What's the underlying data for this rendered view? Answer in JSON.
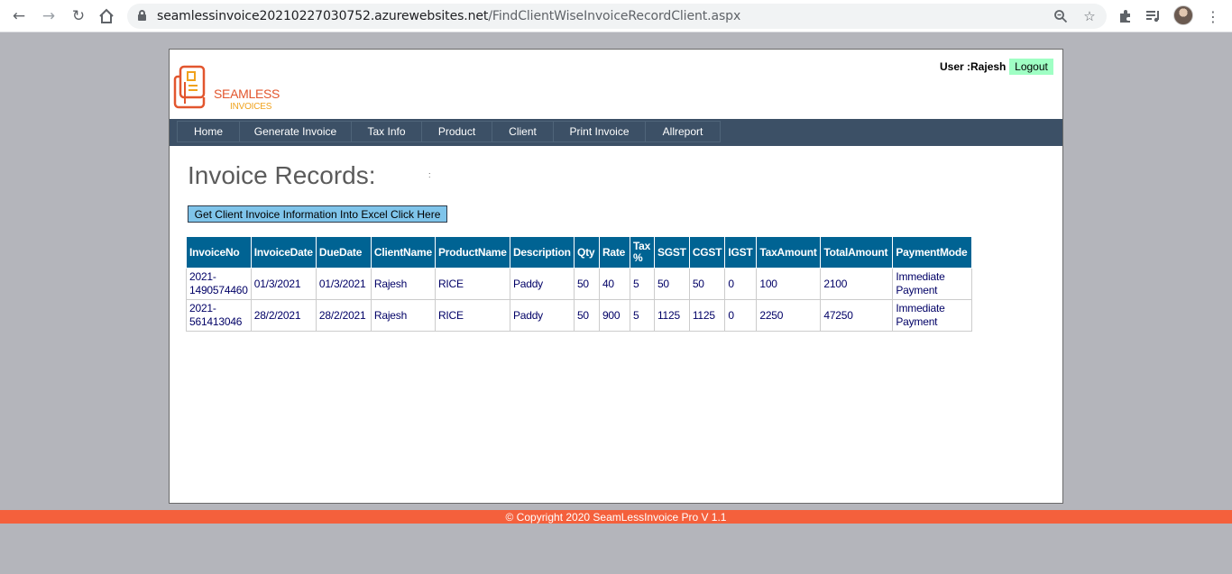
{
  "browser": {
    "url_host": "seamlessinvoice20210227030752.azurewebsites.net",
    "url_path": "/FindClientWiseInvoiceRecordClient.aspx"
  },
  "logo": {
    "line1": "SEAMLESS",
    "line2": "INVOICES",
    "colors": {
      "primary": "#e2562e",
      "secondary": "#f0a21c"
    }
  },
  "header": {
    "user_label": "User :Rajesh",
    "logout_label": "Logout"
  },
  "nav": {
    "items": [
      "Home",
      "Generate Invoice",
      "Tax Info",
      "Product",
      "Client",
      "Print Invoice",
      "Allreport"
    ]
  },
  "main": {
    "title": "Invoice Records:",
    "marker": ":",
    "excel_button": "Get Client Invoice Information Into Excel Click Here"
  },
  "table": {
    "headers": [
      "InvoiceNo",
      "InvoiceDate",
      "DueDate",
      "ClientName",
      "ProductName",
      "Description",
      "Qty",
      "Rate",
      "Tax %",
      "SGST",
      "CGST",
      "IGST",
      "TaxAmount",
      "TotalAmount",
      "PaymentMode"
    ],
    "rows": [
      [
        "2021-1490574460",
        "01/3/2021",
        "01/3/2021",
        "Rajesh",
        "RICE",
        "Paddy",
        "50",
        "40",
        "5",
        "50",
        "50",
        "0",
        "100",
        "2100",
        "Immediate Payment"
      ],
      [
        "2021-561413046",
        "28/2/2021",
        "28/2/2021",
        "Rajesh",
        "RICE",
        "Paddy",
        "50",
        "900",
        "5",
        "1125",
        "1125",
        "0",
        "2250",
        "47250",
        "Immediate Payment"
      ]
    ]
  },
  "footer": {
    "text": "© Copyright 2020 SeamLessInvoice Pro V 1.1"
  },
  "colors": {
    "nav_bg": "#3c5066",
    "table_header_bg": "#006393",
    "footer_bg": "#f4603c",
    "logout_bg": "#9fffc4",
    "excel_button_bg": "#7fc4ea"
  }
}
